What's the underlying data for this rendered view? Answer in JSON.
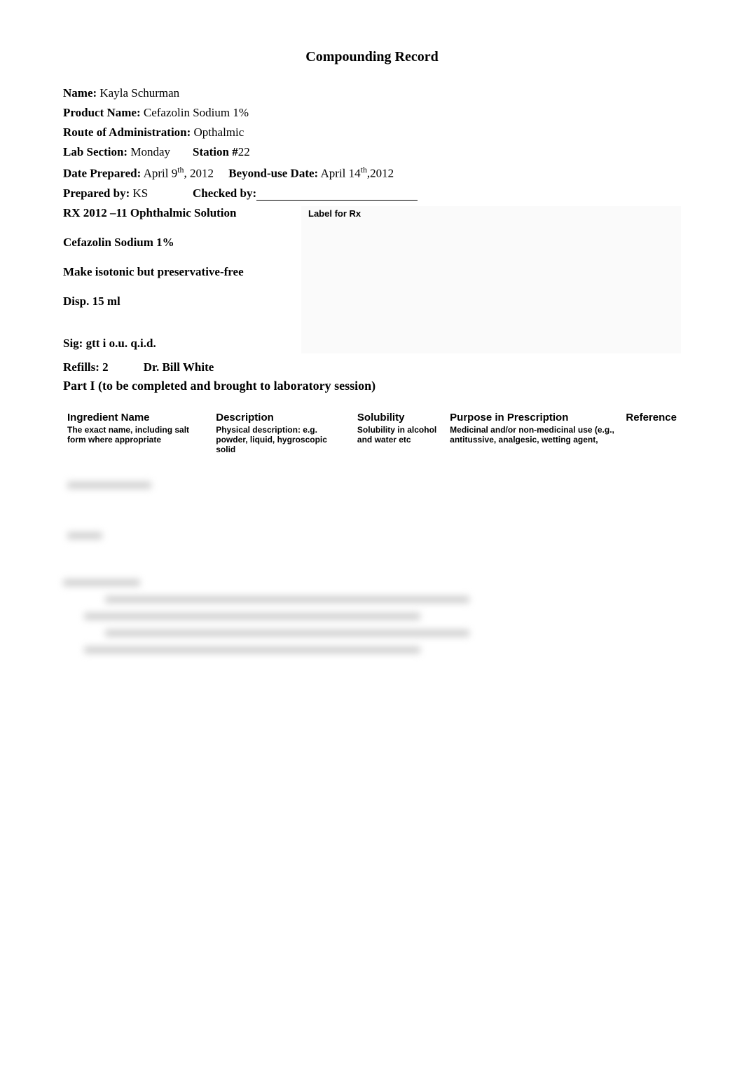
{
  "title": "Compounding Record",
  "fields": {
    "name_label": "Name:",
    "name_value": "Kayla Schurman",
    "product_label": "Product Name:",
    "product_value": "Cefazolin Sodium 1%",
    "route_label": "Route of Administration:",
    "route_value": "Opthalmic",
    "lab_section_label": "Lab Section:",
    "lab_section_value": "Monday",
    "station_label": "Station #",
    "station_value": "22",
    "date_prepared_label": "Date Prepared:",
    "date_prepared_value": "April 9",
    "date_prepared_sup": "th",
    "date_prepared_year": ", 2012",
    "beyond_label": "Beyond-use Date:",
    "beyond_value": "April 14",
    "beyond_sup": "th",
    "beyond_year": ",2012",
    "prepared_by_label": "Prepared by:",
    "prepared_by_value": "KS",
    "checked_by_label": "Checked by:"
  },
  "rx": {
    "rx_number": "RX 2012 –11 Ophthalmic Solution",
    "label_for_rx": "Label for Rx",
    "line1": "Cefazolin Sodium 1%",
    "line2": "Make isotonic but preservative-free",
    "line3": "Disp. 15 ml",
    "sig": "Sig: gtt i o.u. q.i.d.",
    "refills_label": "Refills: 2",
    "doctor": "Dr. Bill White"
  },
  "part1": {
    "heading": "Part I (to be completed and brought to laboratory session)",
    "headers": {
      "h1": "Ingredient Name",
      "h1sub": "The exact name, including salt form where appropriate",
      "h2": "Description",
      "h2sub": "Physical description: e.g. powder, liquid, hygroscopic solid",
      "h3": "Solubility",
      "h3sub": "Solubility in alcohol and water etc",
      "h4": "Purpose in Prescription",
      "h4sub": "Medicinal and/or non-medicinal use (e.g., antitussive, analgesic, wetting agent,",
      "h5": "Reference"
    }
  }
}
